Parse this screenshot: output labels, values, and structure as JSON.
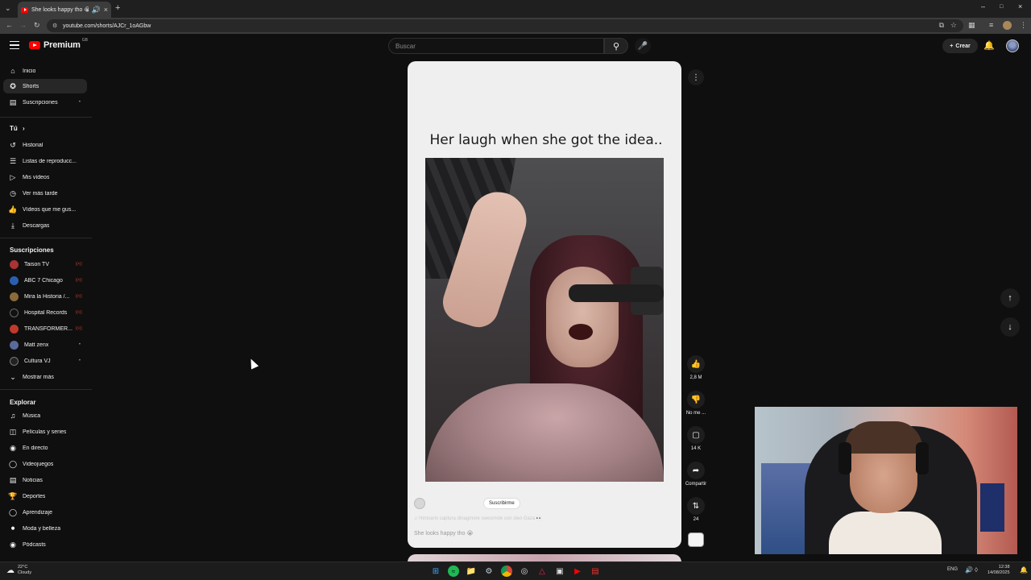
{
  "browser": {
    "tab_title": "She looks happy tho 😭 - Y",
    "url": "youtube.com/shorts/AJCr_1oAGbw",
    "new_tab": "+"
  },
  "header": {
    "logo": "Premium",
    "logo_country": "GB",
    "search_placeholder": "Buscar",
    "create_label": "Crear"
  },
  "sidebar": {
    "main": [
      {
        "label": "Inicio",
        "icon": "home-icon"
      },
      {
        "label": "Shorts",
        "icon": "shorts-icon"
      },
      {
        "label": "Suscripciones",
        "icon": "subscriptions-icon"
      }
    ],
    "you_title": "Tú",
    "you": [
      {
        "label": "Historial",
        "icon": "history-icon"
      },
      {
        "label": "Listas de reproducc...",
        "icon": "playlists-icon"
      },
      {
        "label": "Mis vídeos",
        "icon": "my-videos-icon"
      },
      {
        "label": "Ver más tarde",
        "icon": "watch-later-icon"
      },
      {
        "label": "Vídeos que me gus...",
        "icon": "liked-icon"
      },
      {
        "label": "Descargas",
        "icon": "downloads-icon"
      }
    ],
    "subs_title": "Suscripciones",
    "subs": [
      {
        "label": "Taison TV",
        "color": "#a33"
      },
      {
        "label": "ABC 7 Chicago",
        "color": "#2a5fb0"
      },
      {
        "label": "Mira la Historia /...",
        "color": "#8a6a3a"
      },
      {
        "label": "Hospital Records",
        "color": "#111"
      },
      {
        "label": "TRANSFORMER...",
        "color": "#c0392b"
      },
      {
        "label": "Matt zenx",
        "color": "#5a6a9a"
      },
      {
        "label": "Cultura VJ",
        "color": "#222"
      }
    ],
    "show_more": "Mostrar más",
    "explore_title": "Explorar",
    "explore": [
      {
        "label": "Música",
        "icon": "music-icon"
      },
      {
        "label": "Películas y series",
        "icon": "movies-icon"
      },
      {
        "label": "En directo",
        "icon": "live-icon"
      },
      {
        "label": "Videojuegos",
        "icon": "gaming-icon"
      },
      {
        "label": "Noticias",
        "icon": "news-icon"
      },
      {
        "label": "Deportes",
        "icon": "sports-icon"
      },
      {
        "label": "Aprendizaje",
        "icon": "learning-icon"
      },
      {
        "label": "Moda y belleza",
        "icon": "fashion-icon"
      },
      {
        "label": "Pódcasts",
        "icon": "podcasts-icon"
      }
    ]
  },
  "short": {
    "caption": "Her laugh when she got the idea..",
    "subscribe": "Suscribirme",
    "music": "♫  Himnario captura dinagmore swesmole con sleo Gaza 👀",
    "title": "She looks happy tho 😭"
  },
  "actions": {
    "likes": "2,8 M",
    "dislike": "No me ...",
    "comments": "14 K",
    "share": "Compartir",
    "remix": "24"
  },
  "taskbar": {
    "temp": "22°C",
    "weather": "Cloudy",
    "lang": "ENG",
    "time": "12:38",
    "date": "14/08/2025"
  }
}
